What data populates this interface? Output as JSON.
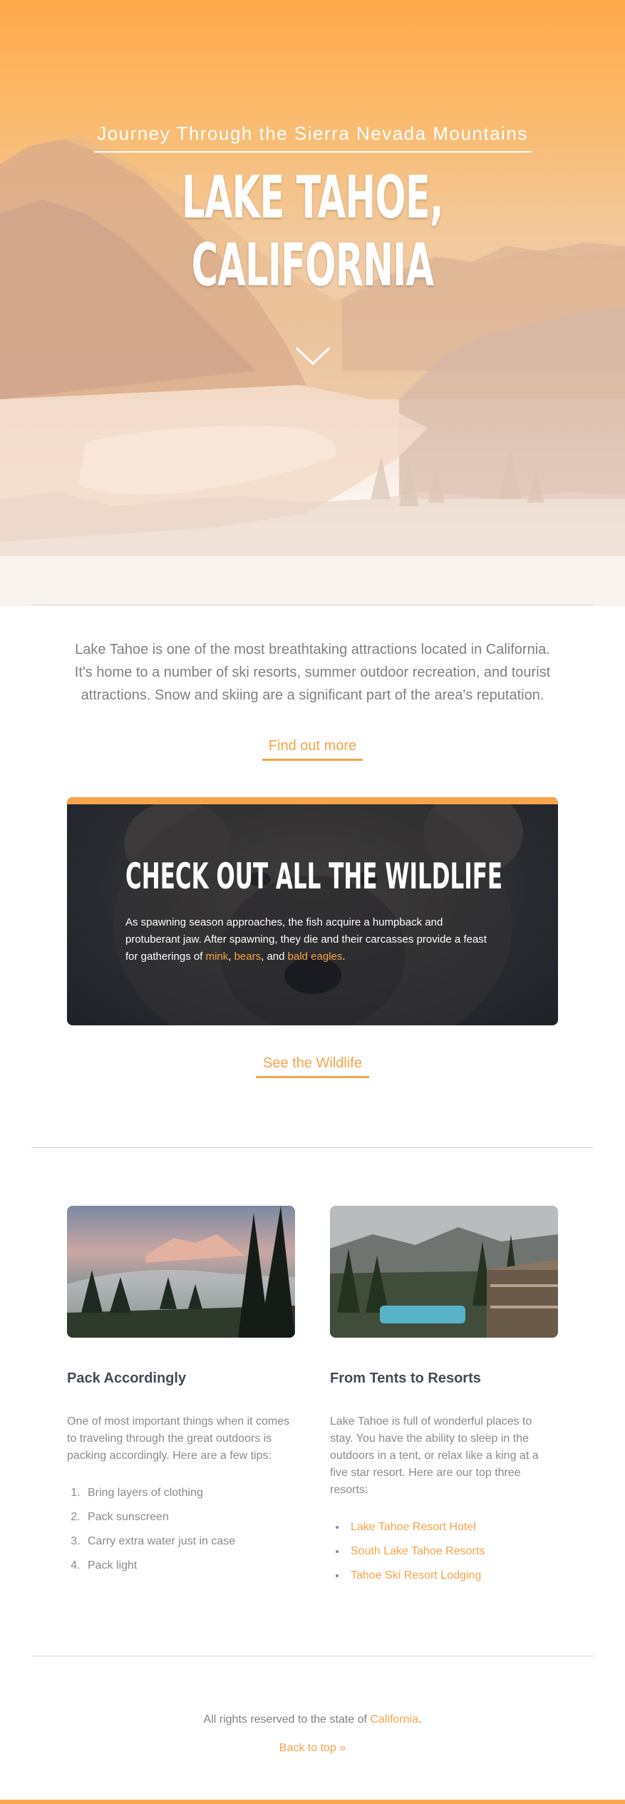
{
  "hero": {
    "subtitle": "Journey Through the Sierra Nevada Mountains",
    "title": "LAKE TAHOE, CALIFORNIA"
  },
  "intro": {
    "text": "Lake Tahoe is one of the most breathtaking attractions located in California. It's home to a number of ski resorts, summer outdoor recreation, and tourist attractions. Snow and skiing are a significant part of the area's reputation.",
    "cta_label": "Find out more"
  },
  "wildlife": {
    "title": "CHECK OUT ALL THE WILDLIFE",
    "text_before": "As spawning season approaches, the fish acquire a humpback and protuberant jaw. After spawning, they die and their carcasses provide a feast for gatherings of ",
    "link_mink": "mink",
    "sep1": ", ",
    "link_bears": "bears",
    "sep2": ", and ",
    "link_eagles": "bald eagles",
    "end": ".",
    "cta_label": "See the Wildlife"
  },
  "columns": {
    "left": {
      "heading": "Pack Accordingly",
      "text": "One of most important things when it comes to traveling through the great outdoors is packing accordingly. Here are a few tips:",
      "items": [
        "Bring layers of clothing",
        "Pack sunscreen",
        "Carry extra water just in case",
        "Pack light"
      ]
    },
    "right": {
      "heading": "From Tents to Resorts",
      "text": "Lake Tahoe is full of wonderful places to stay. You have the ability to sleep in the outdoors in a tent, or relax like a king at a five star resort. Here are our top three resorts:",
      "items": [
        "Lake Tahoe Resort Hotel",
        "South Lake Tahoe Resorts",
        "Tahoe Ski Resort Lodging"
      ]
    }
  },
  "footer": {
    "text": "All rights reserved to the state of ",
    "link": "California",
    "end": ".",
    "back_to_top": "Back to top »"
  },
  "colors": {
    "accent": "#f7a44a",
    "heading": "#444a55",
    "body_text": "#808080"
  },
  "icons": {
    "scroll": "chevron-down-icon"
  }
}
